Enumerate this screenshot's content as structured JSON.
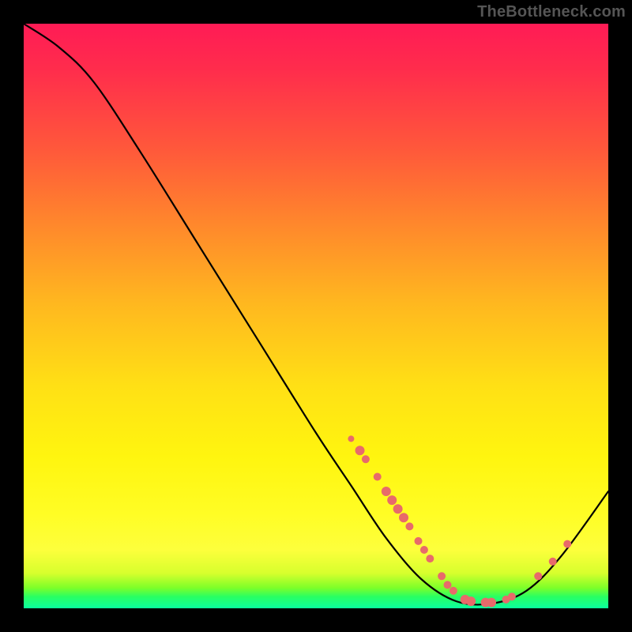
{
  "watermark": "TheBottleneck.com",
  "chart_data": {
    "type": "line",
    "title": "",
    "xlabel": "",
    "ylabel": "",
    "xlim": [
      0,
      100
    ],
    "ylim": [
      0,
      100
    ],
    "series": [
      {
        "name": "curve",
        "points": [
          {
            "x": 0,
            "y": 100
          },
          {
            "x": 6,
            "y": 96
          },
          {
            "x": 12,
            "y": 90
          },
          {
            "x": 20,
            "y": 78
          },
          {
            "x": 30,
            "y": 62
          },
          {
            "x": 40,
            "y": 46
          },
          {
            "x": 50,
            "y": 30
          },
          {
            "x": 56,
            "y": 21
          },
          {
            "x": 62,
            "y": 12
          },
          {
            "x": 68,
            "y": 5
          },
          {
            "x": 74,
            "y": 1.2
          },
          {
            "x": 80,
            "y": 0.8
          },
          {
            "x": 86,
            "y": 3
          },
          {
            "x": 92,
            "y": 9
          },
          {
            "x": 100,
            "y": 20
          }
        ]
      }
    ],
    "markers": [
      {
        "x": 56.0,
        "y": 29.0,
        "r": 4
      },
      {
        "x": 57.5,
        "y": 27.0,
        "r": 6
      },
      {
        "x": 58.5,
        "y": 25.5,
        "r": 5
      },
      {
        "x": 60.5,
        "y": 22.5,
        "r": 5
      },
      {
        "x": 62.0,
        "y": 20.0,
        "r": 6
      },
      {
        "x": 63.0,
        "y": 18.5,
        "r": 6
      },
      {
        "x": 64.0,
        "y": 17.0,
        "r": 6
      },
      {
        "x": 65.0,
        "y": 15.5,
        "r": 6
      },
      {
        "x": 66.0,
        "y": 14.0,
        "r": 5
      },
      {
        "x": 67.5,
        "y": 11.5,
        "r": 5
      },
      {
        "x": 68.5,
        "y": 10.0,
        "r": 5
      },
      {
        "x": 69.5,
        "y": 8.5,
        "r": 5
      },
      {
        "x": 71.5,
        "y": 5.5,
        "r": 5
      },
      {
        "x": 72.5,
        "y": 4.0,
        "r": 5
      },
      {
        "x": 73.5,
        "y": 3.0,
        "r": 5
      },
      {
        "x": 75.5,
        "y": 1.5,
        "r": 6
      },
      {
        "x": 76.5,
        "y": 1.2,
        "r": 6
      },
      {
        "x": 79.0,
        "y": 1.0,
        "r": 6
      },
      {
        "x": 80.0,
        "y": 1.0,
        "r": 6
      },
      {
        "x": 82.5,
        "y": 1.5,
        "r": 5
      },
      {
        "x": 83.5,
        "y": 2.0,
        "r": 5
      },
      {
        "x": 88.0,
        "y": 5.5,
        "r": 5
      },
      {
        "x": 90.5,
        "y": 8.0,
        "r": 5
      },
      {
        "x": 93.0,
        "y": 11.0,
        "r": 5
      }
    ],
    "gradient_bands": [
      {
        "pos": 0,
        "color": "#ff1b55"
      },
      {
        "pos": 50,
        "color": "#ffb81f"
      },
      {
        "pos": 85,
        "color": "#fffd25"
      },
      {
        "pos": 100,
        "color": "#0aff9e"
      }
    ]
  }
}
